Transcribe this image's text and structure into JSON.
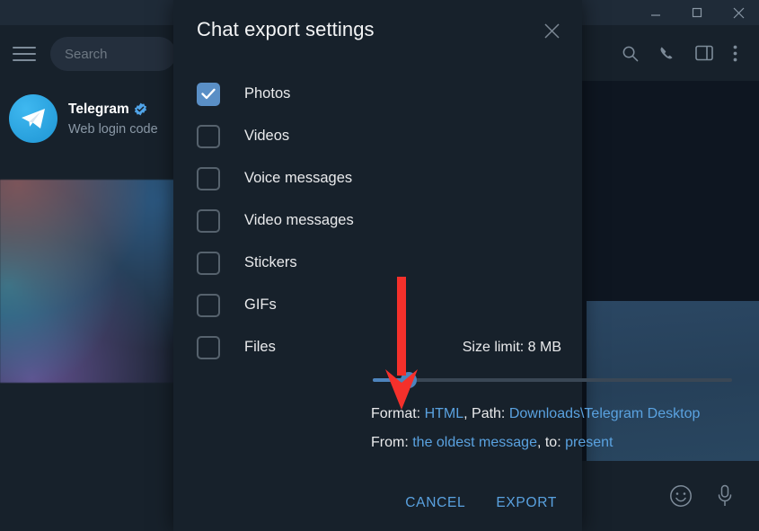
{
  "window": {
    "controls": [
      {
        "name": "minimize",
        "glyph": "minimize-icon"
      },
      {
        "name": "maximize",
        "glyph": "maximize-icon"
      },
      {
        "name": "close",
        "glyph": "close-icon"
      }
    ]
  },
  "sidebar": {
    "menu_icon": "hamburger-menu-icon",
    "search": {
      "placeholder": "Search",
      "value": ""
    },
    "chat": {
      "name": "Telegram",
      "verified_badge": "verified-icon",
      "preview": "Web login code"
    }
  },
  "chat_pane": {
    "header_icons": [
      "search-icon",
      "phone-icon",
      "split-view-icon",
      "more-vertical-icon"
    ],
    "composer_icons": [
      "emoji-icon",
      "microphone-icon"
    ]
  },
  "dialog": {
    "title": "Chat export settings",
    "close_icon": "close-icon",
    "options": [
      {
        "label": "Photos",
        "checked": true,
        "icon": "checkbox-checked-icon"
      },
      {
        "label": "Videos",
        "checked": false,
        "icon": "checkbox-icon"
      },
      {
        "label": "Voice messages",
        "checked": false,
        "icon": "checkbox-icon"
      },
      {
        "label": "Video messages",
        "checked": false,
        "icon": "checkbox-icon"
      },
      {
        "label": "Stickers",
        "checked": false,
        "icon": "checkbox-icon"
      },
      {
        "label": "GIFs",
        "checked": false,
        "icon": "checkbox-icon"
      },
      {
        "label": "Files",
        "checked": false,
        "icon": "checkbox-icon"
      }
    ],
    "size_limit": "Size limit: 8 MB",
    "slider": {
      "value_percent": 10
    },
    "format_line": {
      "format_prefix": "Format: ",
      "format_value": "HTML",
      "path_prefix": ", Path: ",
      "path_value": "Downloads\\Telegram Desktop"
    },
    "range_line": {
      "from_prefix": "From: ",
      "from_value": "the oldest message",
      "to_prefix": ", to: ",
      "to_value": "present"
    },
    "cancel_label": "CANCEL",
    "export_label": "EXPORT"
  },
  "annotation": {
    "arrow": "down-arrow-annotation",
    "color": "#f5302b"
  },
  "colors": {
    "accent": "#5aa2e0",
    "dialog_bg": "#17212b",
    "app_bg": "#0e1621",
    "checkbox_checked": "#5a8fc6",
    "slider": "#4d84bd"
  }
}
